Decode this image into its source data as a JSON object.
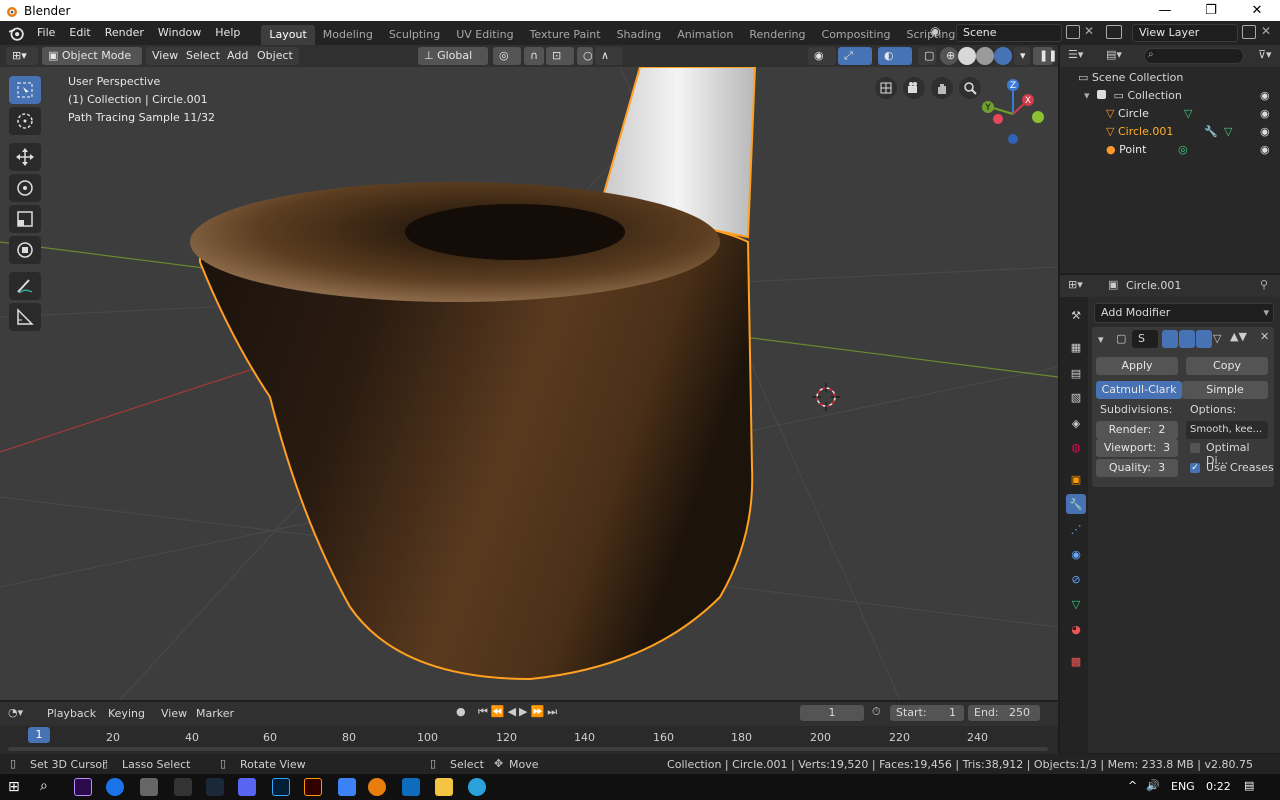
{
  "window": {
    "title": "Blender",
    "minimize": "—",
    "maximize": "❐",
    "close": "✕"
  },
  "menus": [
    "File",
    "Edit",
    "Render",
    "Window",
    "Help"
  ],
  "workspaces": [
    "Layout",
    "Modeling",
    "Sculpting",
    "UV Editing",
    "Texture Paint",
    "Shading",
    "Animation",
    "Rendering",
    "Compositing",
    "Scripting"
  ],
  "active_workspace": "Layout",
  "add_workspace": "+",
  "scene": {
    "name": "Scene"
  },
  "view_layer": {
    "name": "View Layer"
  },
  "viewport_header": {
    "mode": "Object Mode",
    "view": "View",
    "select": "Select",
    "add": "Add",
    "object": "Object",
    "orientation": "Global"
  },
  "viewport": {
    "line1": "User Perspective",
    "line2": "(1) Collection | Circle.001",
    "line3": "Path Tracing Sample 11/32",
    "gizmo": {
      "x": "X",
      "y": "Y",
      "z": "Z"
    }
  },
  "outliner": {
    "search_placeholder": "",
    "root": "Scene Collection",
    "collection": "Collection",
    "items": [
      {
        "name": "Circle",
        "color": "#e6e6e6"
      },
      {
        "name": "Circle.001",
        "color": "#ffaf29"
      },
      {
        "name": "Point",
        "color": "#e6e6e6"
      }
    ]
  },
  "properties": {
    "object_name": "Circle.001",
    "add_modifier": "Add Modifier",
    "modifier_name": "S",
    "apply": "Apply",
    "copy": "Copy",
    "catmull_clark": "Catmull-Clark",
    "simple": "Simple",
    "subdivisions_label": "Subdivisions:",
    "options_label": "Options:",
    "render_label": "Render:",
    "render_value": "2",
    "viewport_label": "Viewport:",
    "viewport_value": "3",
    "quality_label": "Quality:",
    "quality_value": "3",
    "smooth_option": "Smooth, kee...",
    "optimal_display": "Optimal Di...",
    "optimal_checked": false,
    "use_creases": "Use Creases",
    "use_creases_checked": true
  },
  "timeline": {
    "playback": "Playback",
    "keying": "Keying",
    "view": "View",
    "marker": "Marker",
    "current_frame": "1",
    "start_label": "Start:",
    "start_value": "1",
    "end_label": "End:",
    "end_value": "250",
    "frame_marker": "1",
    "ruler": [
      "20",
      "40",
      "60",
      "80",
      "100",
      "120",
      "140",
      "160",
      "180",
      "200",
      "220",
      "240"
    ]
  },
  "status": {
    "set_cursor": "Set 3D Cursor",
    "lasso": "Lasso Select",
    "rotate": "Rotate View",
    "select": "Select",
    "move": "Move",
    "info": "Collection | Circle.001 | Verts:19,520 | Faces:19,456 | Tris:38,912 | Objects:1/3 | Mem: 233.8 MB | v2.80.75"
  },
  "taskbar": {
    "lang": "ENG",
    "time": "0:22"
  },
  "colors": {
    "accent": "#4772b3",
    "selected": "#ffaf29"
  }
}
